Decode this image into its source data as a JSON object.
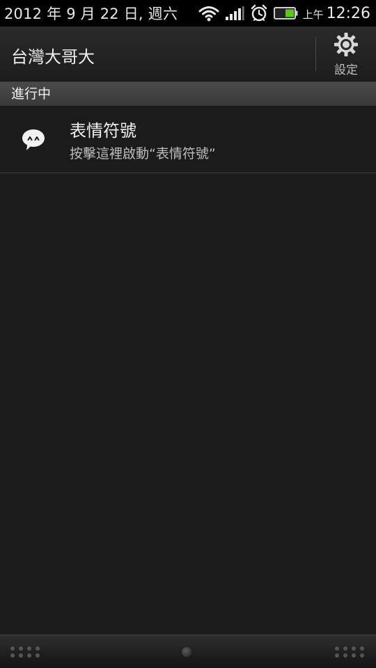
{
  "status_bar": {
    "date": "2012 年 9 月 22 日, 週六",
    "ampm": "上午",
    "time": "12:26",
    "icons": [
      "wifi-icon",
      "signal-icon",
      "alarm-clock-icon",
      "battery-icon"
    ]
  },
  "header": {
    "carrier": "台灣大哥大",
    "settings_label": "設定"
  },
  "section": {
    "title": "進行中"
  },
  "notification": {
    "title": "表情符號",
    "text": "按擊這裡啟動“表情符號”",
    "icon": "emoticon-chat-bubble-icon"
  },
  "colors": {
    "background": "#1b1b1b",
    "battery_level": "#5bc81e"
  }
}
